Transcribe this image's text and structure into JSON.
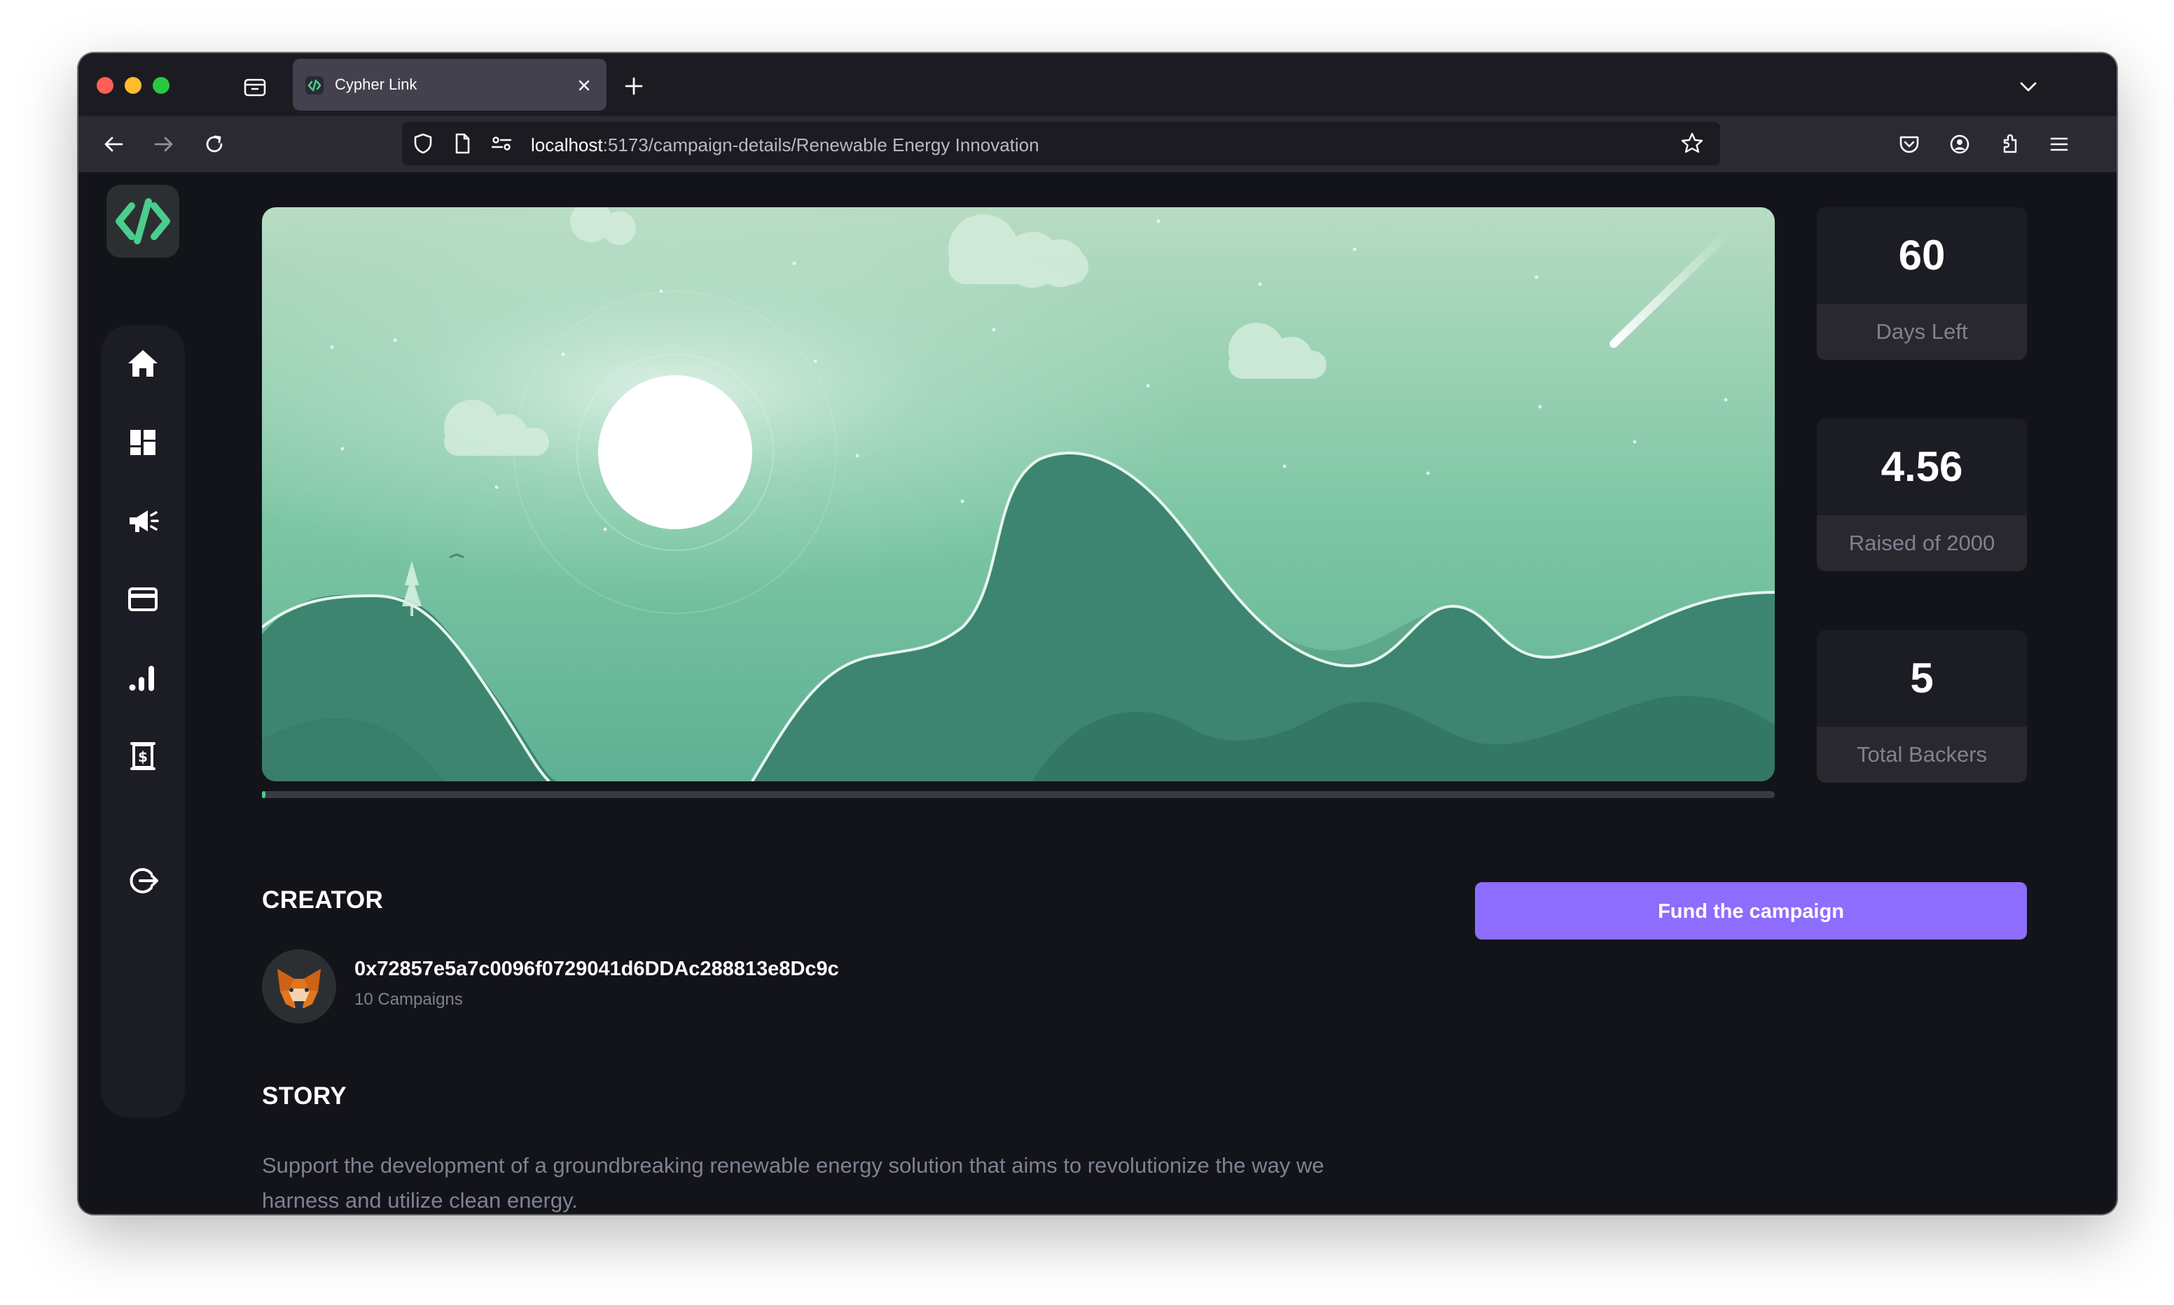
{
  "browser": {
    "tab_title": "Cypher Link",
    "url_host": "localhost",
    "url_path": ":5173/campaign-details/Renewable Energy Innovation"
  },
  "sidebar": {
    "items": [
      {
        "icon": "home-icon"
      },
      {
        "icon": "dashboard-icon"
      },
      {
        "icon": "campaign-icon"
      },
      {
        "icon": "payment-icon"
      },
      {
        "icon": "analytics-icon"
      },
      {
        "icon": "withdraw-icon"
      },
      {
        "icon": "logout-icon"
      }
    ]
  },
  "campaign": {
    "progress_fraction": 0.00228
  },
  "stats": {
    "days_left": {
      "value": "60",
      "label": "Days Left"
    },
    "raised": {
      "value": "4.56",
      "label": "Raised of 2000"
    },
    "backers": {
      "value": "5",
      "label": "Total Backers"
    }
  },
  "creator": {
    "section_title": "CREATOR",
    "address": "0x72857e5a7c0096f0729041d6DDAc288813e8Dc9c",
    "campaigns_count": "10 Campaigns"
  },
  "story": {
    "section_title": "STORY",
    "text": "Support the development of a groundbreaking renewable energy solution that aims to revolutionize the way we harness and utilize clean energy."
  },
  "fund": {
    "button_label": "Fund the campaign"
  },
  "colors": {
    "accent": "#8c6dfd",
    "brand": "#4acd8d",
    "background": "#13131a",
    "card": "#1c1c24"
  }
}
